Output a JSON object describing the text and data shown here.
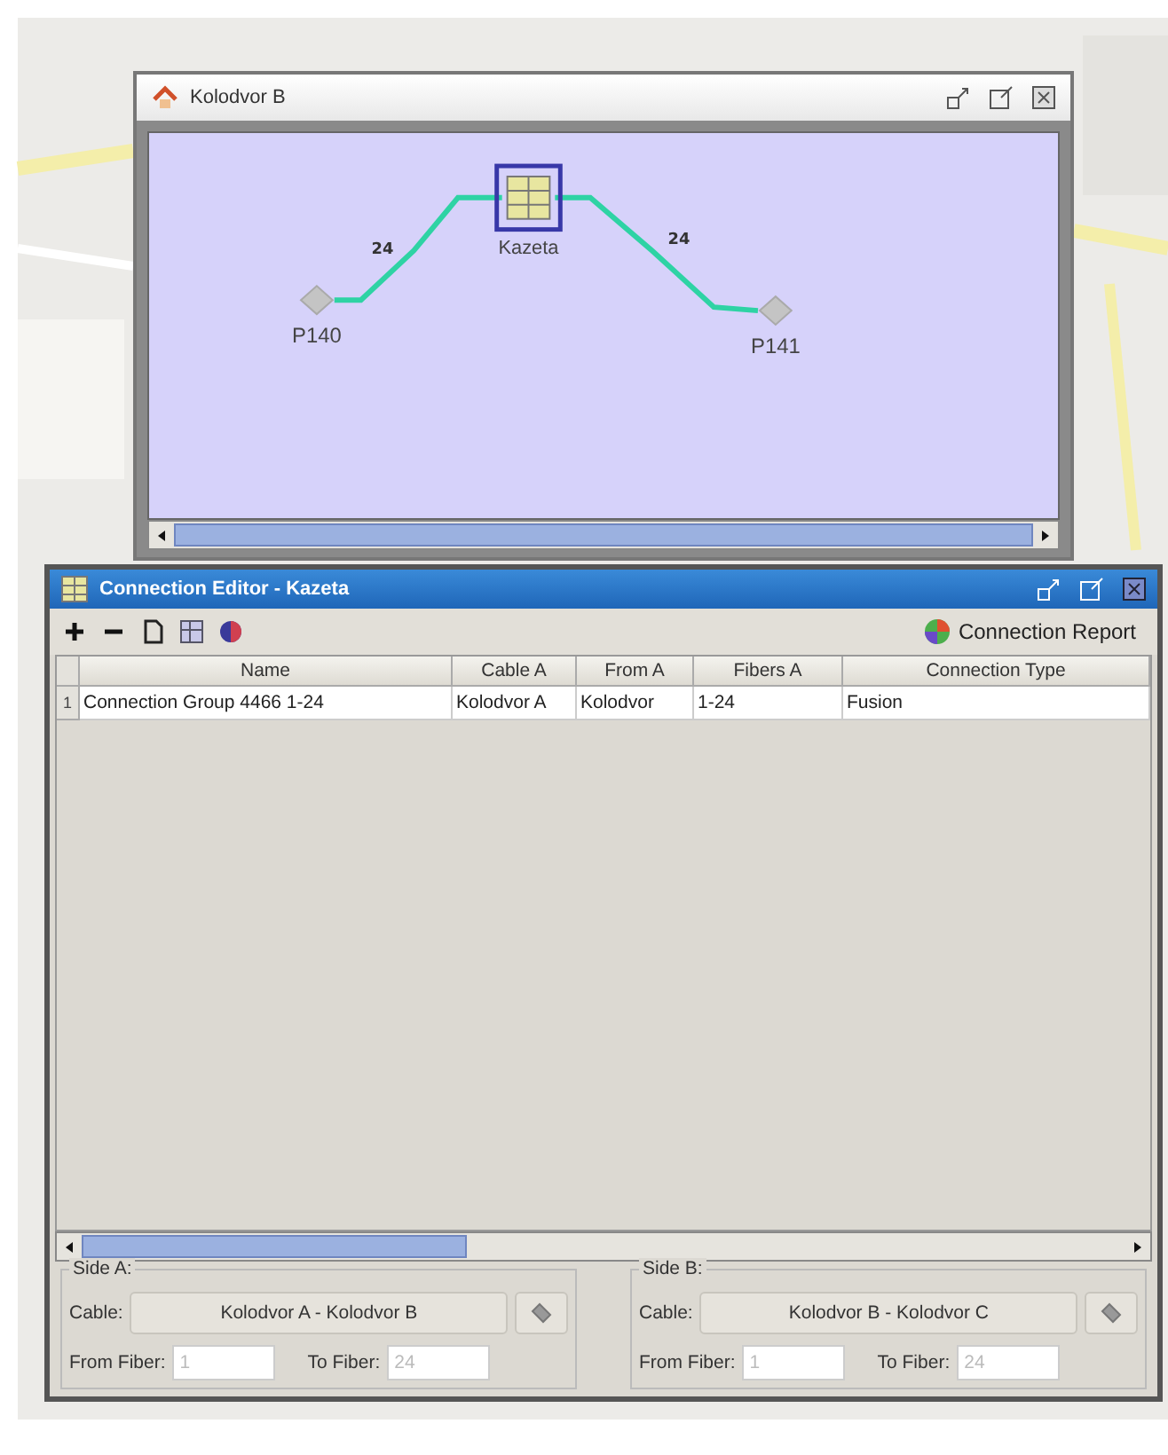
{
  "map_window": {
    "title": "Kolodvor B",
    "nodes": [
      {
        "label": "P140",
        "kind": "pole"
      },
      {
        "label": "Kazeta",
        "kind": "cassette",
        "selected": true
      },
      {
        "label": "P141",
        "kind": "pole"
      }
    ],
    "links": [
      {
        "label": "24"
      },
      {
        "label": "24"
      }
    ]
  },
  "editor": {
    "title": "Connection Editor - Kazeta",
    "report_button": "Connection Report",
    "table": {
      "columns": [
        "Name",
        "Cable A",
        "From A",
        "Fibers A",
        "Connection Type"
      ],
      "rows": [
        {
          "index": "1",
          "cells": [
            "Connection Group 4466 1-24",
            "Kolodvor A",
            "Kolodvor",
            "1-24",
            "Fusion"
          ]
        }
      ]
    },
    "sides": [
      {
        "title": "Side A:",
        "cable_label": "Cable:",
        "cable": "Kolodvor A - Kolodvor B",
        "from_label": "From Fiber:",
        "from_value": "1",
        "to_label": "To Fiber:",
        "to_value": "24",
        "disabled": true
      },
      {
        "title": "Side B:",
        "cable_label": "Cable:",
        "cable": "Kolodvor B - Kolodvor C",
        "from_label": "From Fiber:",
        "from_value": "1",
        "to_label": "To Fiber:",
        "to_value": "24",
        "disabled": true
      }
    ]
  }
}
